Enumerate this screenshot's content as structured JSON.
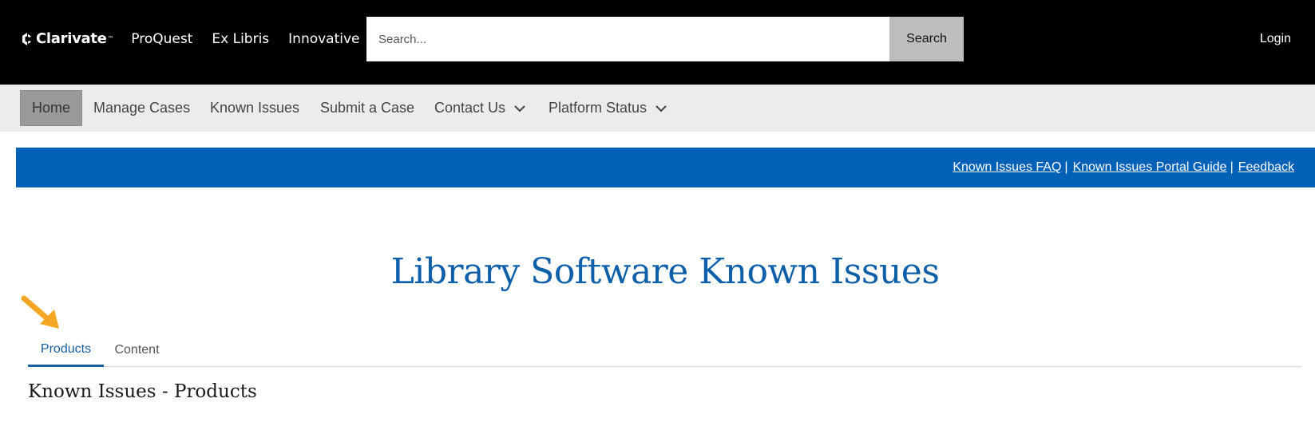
{
  "header": {
    "logo_text": "Clarivate",
    "logo_tm": "™",
    "brands": [
      "ProQuest",
      "Ex Libris",
      "Innovative"
    ],
    "search": {
      "placeholder": "Search...",
      "button_label": "Search"
    },
    "login_label": "Login"
  },
  "nav": {
    "items": [
      {
        "label": "Home",
        "active": true
      },
      {
        "label": "Manage Cases"
      },
      {
        "label": "Known Issues"
      },
      {
        "label": "Submit a Case"
      },
      {
        "label": "Contact Us",
        "has_dropdown": true
      },
      {
        "label": "Platform Status",
        "has_dropdown": true
      }
    ]
  },
  "banner": {
    "links": [
      "Known Issues FAQ",
      "Known Issues Portal Guide",
      "Feedback"
    ],
    "separator": "|",
    "color": "#0061b6"
  },
  "main": {
    "title": "Library Software Known Issues",
    "tabs": [
      {
        "label": "Products",
        "active": true
      },
      {
        "label": "Content"
      }
    ],
    "section_title": "Known Issues - Products",
    "accent_color": "#0c5fa8",
    "annotation_arrow_color": "#f5a623"
  }
}
